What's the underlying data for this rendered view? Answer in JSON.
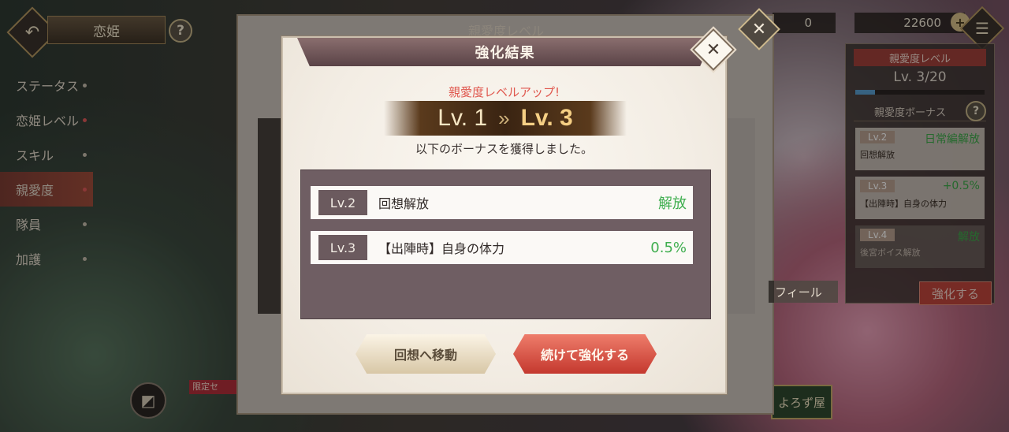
{
  "header": {
    "title": "恋姫",
    "back_icon": "↶",
    "help_label": "?",
    "menu_icon": "☰"
  },
  "side_menu": {
    "items": [
      {
        "label": "ステータス"
      },
      {
        "label": "恋姫レベル"
      },
      {
        "label": "スキル"
      },
      {
        "label": "親愛度"
      },
      {
        "label": "隊員"
      },
      {
        "label": "加護"
      }
    ]
  },
  "currency": {
    "gems": "0",
    "gold": "22600",
    "plus": "+"
  },
  "right_panel": {
    "head": "親愛度レベル",
    "level": "Lv.  3/20",
    "bonus_head": "親愛度ボーナス",
    "help": "?",
    "cards": [
      {
        "lv": "Lv.2",
        "value": "日常編解放",
        "desc": "回想解放"
      },
      {
        "lv": "Lv.3",
        "value": "+0.5%",
        "desc": "【出陣時】自身の体力"
      },
      {
        "lv": "Lv.4",
        "value": "解放",
        "desc": "後宮ボイス解放"
      }
    ],
    "enhance_button": "強化する"
  },
  "background_dialog": {
    "title": "親愛度レベル",
    "profile_label": "フィール"
  },
  "bottom": {
    "limited_tag": "限定セ",
    "shop_label": "よろず屋"
  },
  "modal": {
    "title": "強化結果",
    "levelup_text": "親愛度レベルアップ!",
    "from_level": "Lv. 1",
    "arrow": "»",
    "to_level": "Lv. 3",
    "obtained_text": "以下のボーナスを獲得しました。",
    "bonuses": [
      {
        "lv": "Lv.2",
        "name": "回想解放",
        "value": "解放"
      },
      {
        "lv": "Lv.3",
        "name": "【出陣時】自身の体力",
        "value": "0.5%"
      }
    ],
    "btn_memory": "回想へ移動",
    "btn_continue": "続けて強化する",
    "close": "✕"
  }
}
